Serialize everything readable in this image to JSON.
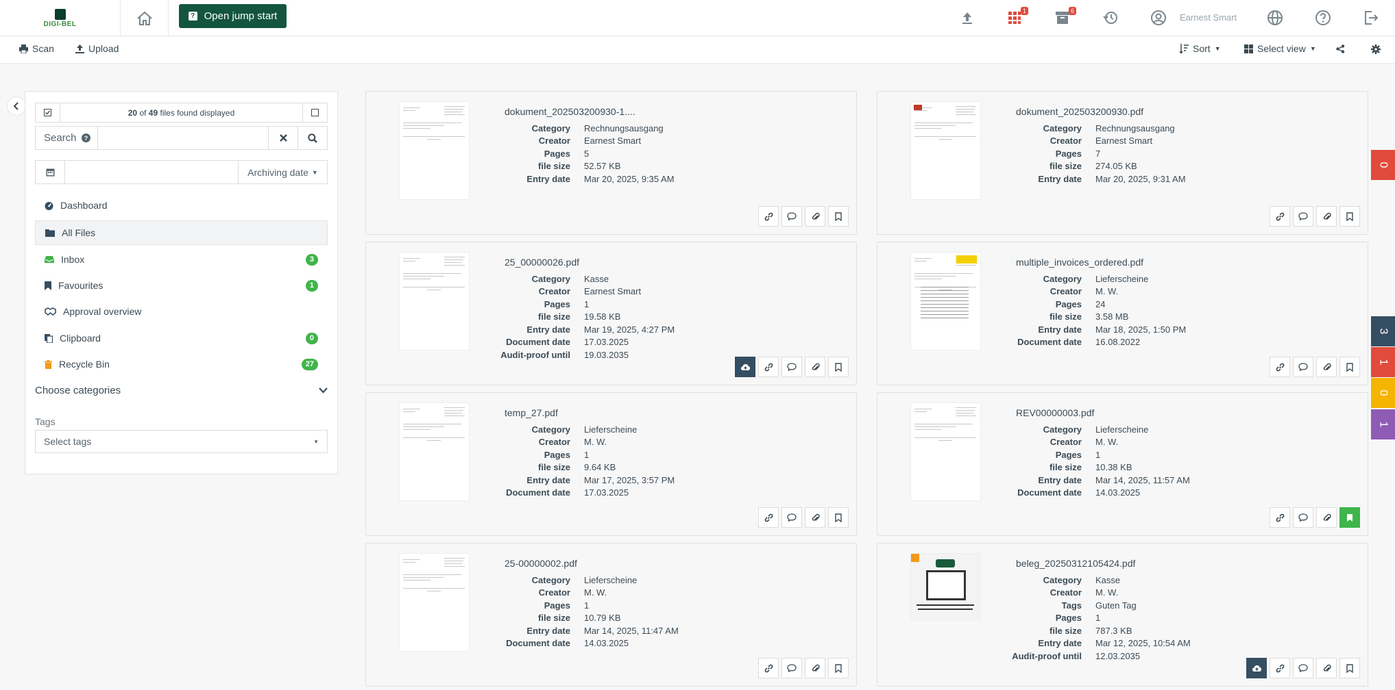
{
  "header": {
    "logo_text": "DIGI-BEL",
    "jump_start_label": "Open jump start",
    "apps_badge": "1",
    "archive_badge": "6",
    "user_name": "Earnest Smart"
  },
  "toolbar": {
    "scan_label": "Scan",
    "upload_label": "Upload",
    "sort_label": "Sort",
    "select_view_label": "Select view"
  },
  "sidebar": {
    "count_found": "20",
    "count_of": "of",
    "count_total": "49",
    "count_suffix": "files found displayed",
    "search_label": "Search",
    "search_value": "",
    "date_value": "",
    "date_filter_label": "Archiving date",
    "nav": [
      {
        "label": "Dashboard",
        "badge": ""
      },
      {
        "label": "All Files",
        "badge": ""
      },
      {
        "label": "Inbox",
        "badge": "3"
      },
      {
        "label": "Favourites",
        "badge": "1"
      },
      {
        "label": "Approval overview",
        "badge": ""
      },
      {
        "label": "Clipboard",
        "badge": "0"
      },
      {
        "label": "Recycle Bin",
        "badge": "27"
      }
    ],
    "categories_label": "Choose categories",
    "tags_label": "Tags",
    "tags_placeholder": "Select tags"
  },
  "documents": [
    {
      "name": "dokument_202503200930-1....",
      "fields": [
        [
          "Category",
          "Rechnungsausgang"
        ],
        [
          "Creator",
          "Earnest Smart"
        ],
        [
          "Pages",
          "5"
        ],
        [
          "file size",
          "52.57 KB"
        ],
        [
          "Entry date",
          "Mar 20, 2025, 9:35 AM"
        ]
      ]
    },
    {
      "name": "dokument_202503200930.pdf",
      "fields": [
        [
          "Category",
          "Rechnungsausgang"
        ],
        [
          "Creator",
          "Earnest Smart"
        ],
        [
          "Pages",
          "7"
        ],
        [
          "file size",
          "274.05 KB"
        ],
        [
          "Entry date",
          "Mar 20, 2025, 9:31 AM"
        ]
      ]
    },
    {
      "name": "25_00000026.pdf",
      "fields": [
        [
          "Category",
          "Kasse"
        ],
        [
          "Creator",
          "Earnest Smart"
        ],
        [
          "Pages",
          "1"
        ],
        [
          "file size",
          "19.58 KB"
        ],
        [
          "Entry date",
          "Mar 19, 2025, 4:27 PM"
        ],
        [
          "Document date",
          "17.03.2025"
        ],
        [
          "Audit-proof until",
          "19.03.2035"
        ]
      ]
    },
    {
      "name": "multiple_invoices_ordered.pdf",
      "fields": [
        [
          "Category",
          "Lieferscheine"
        ],
        [
          "Creator",
          "M. W."
        ],
        [
          "Pages",
          "24"
        ],
        [
          "file size",
          "3.58 MB"
        ],
        [
          "Entry date",
          "Mar 18, 2025, 1:50 PM"
        ],
        [
          "Document date",
          "16.08.2022"
        ]
      ]
    },
    {
      "name": "temp_27.pdf",
      "fields": [
        [
          "Category",
          "Lieferscheine"
        ],
        [
          "Creator",
          "M. W."
        ],
        [
          "Pages",
          "1"
        ],
        [
          "file size",
          "9.64 KB"
        ],
        [
          "Entry date",
          "Mar 17, 2025, 3:57 PM"
        ],
        [
          "Document date",
          "17.03.2025"
        ]
      ]
    },
    {
      "name": "REV00000003.pdf",
      "fields": [
        [
          "Category",
          "Lieferscheine"
        ],
        [
          "Creator",
          "M. W."
        ],
        [
          "Pages",
          "1"
        ],
        [
          "file size",
          "10.38 KB"
        ],
        [
          "Entry date",
          "Mar 14, 2025, 11:57 AM"
        ],
        [
          "Document date",
          "14.03.2025"
        ]
      ]
    },
    {
      "name": "25-00000002.pdf",
      "fields": [
        [
          "Category",
          "Lieferscheine"
        ],
        [
          "Creator",
          "M. W."
        ],
        [
          "Pages",
          "1"
        ],
        [
          "file size",
          "10.79 KB"
        ],
        [
          "Entry date",
          "Mar 14, 2025, 11:47 AM"
        ],
        [
          "Document date",
          "14.03.2025"
        ]
      ]
    },
    {
      "name": "beleg_20250312105424.pdf",
      "fields": [
        [
          "Category",
          "Kasse"
        ],
        [
          "Creator",
          "M. W."
        ],
        [
          "Tags",
          "Guten Tag"
        ],
        [
          "Pages",
          "1"
        ],
        [
          "file size",
          "787.3 KB"
        ],
        [
          "Entry date",
          "Mar 12, 2025, 10:54 AM"
        ],
        [
          "Audit-proof until",
          "12.03.2035"
        ]
      ]
    }
  ],
  "side_tabs": [
    "0",
    "3",
    "1",
    "0",
    "1"
  ],
  "colors": {
    "accent": "#13553e",
    "green": "#3fb54a",
    "red": "#e04b3c",
    "dark": "#364e62",
    "yellow": "#f4b400",
    "purple": "#8e5bb5"
  }
}
